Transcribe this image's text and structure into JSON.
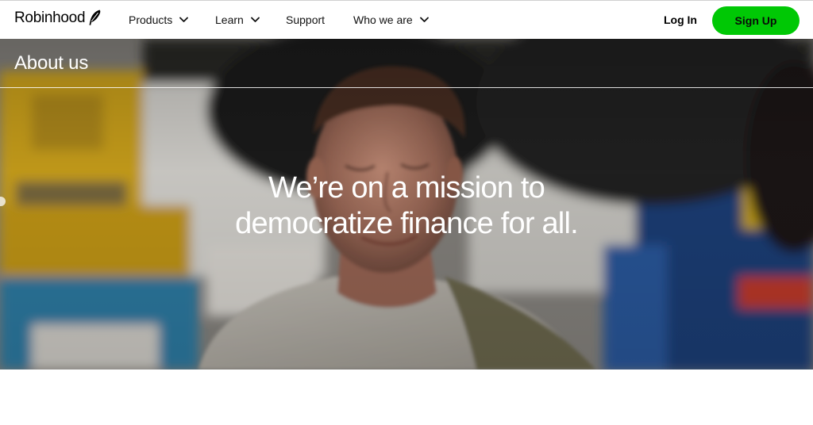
{
  "nav": {
    "brand": "Robinhood",
    "brand_icon": "feather-icon",
    "items": [
      {
        "label": "Products",
        "has_dropdown": true
      },
      {
        "label": "Learn",
        "has_dropdown": true
      },
      {
        "label": "Support",
        "has_dropdown": false
      },
      {
        "label": "Who we are",
        "has_dropdown": true
      }
    ],
    "login_label": "Log In",
    "signup_label": "Sign Up"
  },
  "hero": {
    "section_label": "About us",
    "headline_line1": "We’re on a mission to",
    "headline_line2": "democratize finance for all."
  },
  "colors": {
    "accent": "#00c805",
    "nav_bg": "#ffffff",
    "text_dark": "#000000",
    "hero_text": "#ffffff"
  }
}
